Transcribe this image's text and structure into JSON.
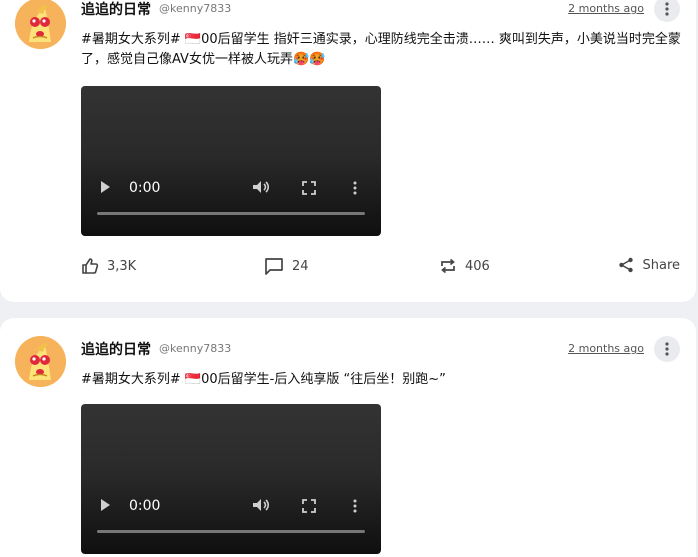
{
  "posts": [
    {
      "author": "追追的日常",
      "handle": "@kenny7833",
      "time": "2 months ago",
      "text": "#暑期女大系列# 🇸🇬00后留学生 指奸三通实录，心理防线完全击溃…… 爽叫到失声，小美说当时完全蒙了，感觉自己像AV女优一样被人玩弄🥵🥵",
      "video_time": "0:00",
      "likes": "3,3K",
      "comments": "24",
      "reposts": "406",
      "share_label": "Share"
    },
    {
      "author": "追追的日常",
      "handle": "@kenny7833",
      "time": "2 months ago",
      "text": "#暑期女大系列# 🇸🇬00后留学生-后入纯享版 “往后坐！别跑~”",
      "video_time": "0:00"
    }
  ],
  "icons": {
    "like": "thumbs-up-icon",
    "comment": "comment-icon",
    "repost": "repost-icon",
    "share": "share-icon",
    "more": "more-vertical-icon",
    "play": "play-icon",
    "volume": "volume-icon",
    "fullscreen": "fullscreen-icon"
  },
  "colors": {
    "background": "#eef0f3",
    "card": "#ffffff",
    "avatar": "#f6b35c"
  }
}
